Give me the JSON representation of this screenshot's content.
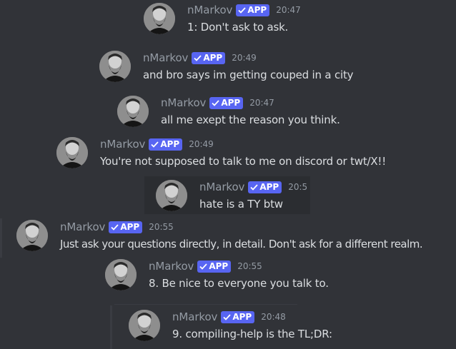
{
  "messages": [
    {
      "author": "nMarkov",
      "badge": "APP",
      "time": "20:47",
      "text": "1: Don't ask to ask."
    },
    {
      "author": "nMarkov",
      "badge": "APP",
      "time": "20:49",
      "text": "and bro says im getting couped in a city"
    },
    {
      "author": "nMarkov",
      "badge": "APP",
      "time": "20:47",
      "text": "all me exept the reason you think."
    },
    {
      "author": "nMarkov",
      "badge": "APP",
      "time": "20:49",
      "text": "You're not supposed to talk to me on discord or twt/X!!"
    },
    {
      "author": "nMarkov",
      "badge": "APP",
      "time": "20:5",
      "text": "hate is a TY btw"
    },
    {
      "author": "nMarkov",
      "badge": "APP",
      "time": "20:55",
      "text": "Just ask your questions directly, in detail. Don't ask for a different realm."
    },
    {
      "author": "nMarkov",
      "badge": "APP",
      "time": "20:55",
      "text": "8. Be nice to everyone you talk to."
    },
    {
      "author": "nMarkov",
      "badge": "APP",
      "time": "20:48",
      "text": "9. compiling-help is the TL;DR:"
    }
  ],
  "colors": {
    "background": "#313338",
    "badge": "#5865f2",
    "username": "#949ba4",
    "text": "#dbdee1",
    "highlight": "#2b2d31"
  }
}
